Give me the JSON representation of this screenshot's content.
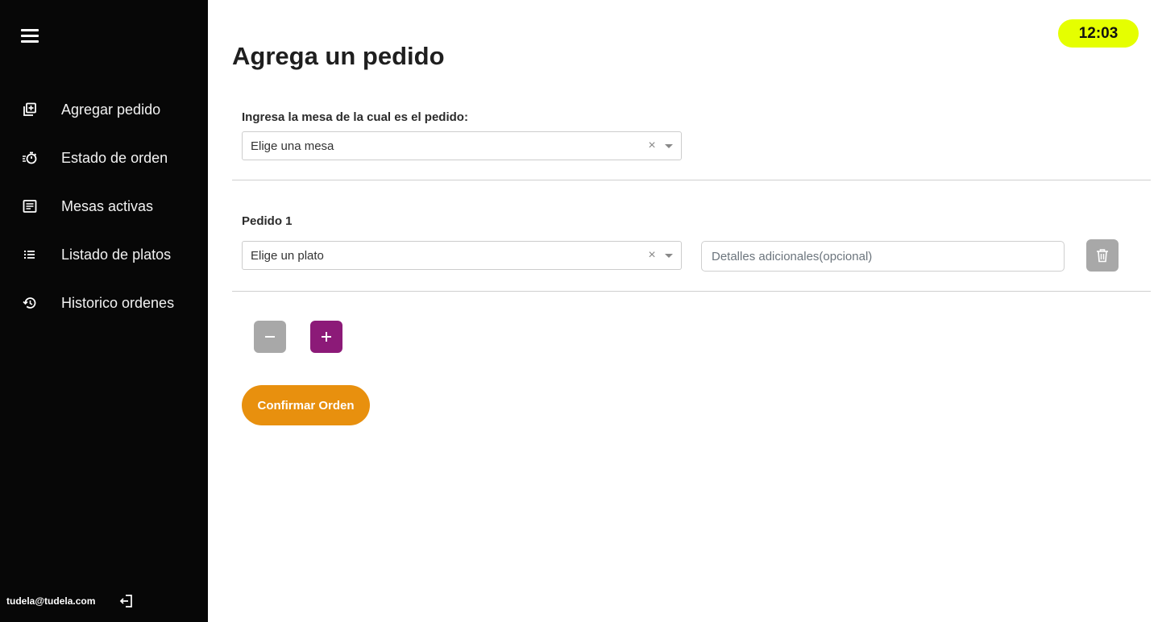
{
  "sidebar": {
    "items": [
      {
        "label": "Agregar pedido",
        "icon": "add-box-icon"
      },
      {
        "label": "Estado de orden",
        "icon": "timer-icon"
      },
      {
        "label": "Mesas activas",
        "icon": "list-alt-icon"
      },
      {
        "label": "Listado de platos",
        "icon": "list-icon"
      },
      {
        "label": "Historico ordenes",
        "icon": "history-icon"
      }
    ],
    "user_email": "tudela@tudela.com"
  },
  "clock": {
    "time": "12:03"
  },
  "main": {
    "title": "Agrega un pedido",
    "table_label": "Ingresa la mesa de la cual es el pedido:",
    "table_select_placeholder": "Elige una mesa",
    "order": {
      "label": "Pedido 1",
      "dish_placeholder": "Elige un plato",
      "details_placeholder": "Detalles adicionales(opcional)"
    },
    "confirm_label": "Confirmar Orden"
  },
  "colors": {
    "sidebar_bg": "#070707",
    "clock_bg": "#e5ff00",
    "plus_button": "#8c1a78",
    "confirm_button": "#e8900e",
    "disabled_button": "#a8a8a8"
  }
}
